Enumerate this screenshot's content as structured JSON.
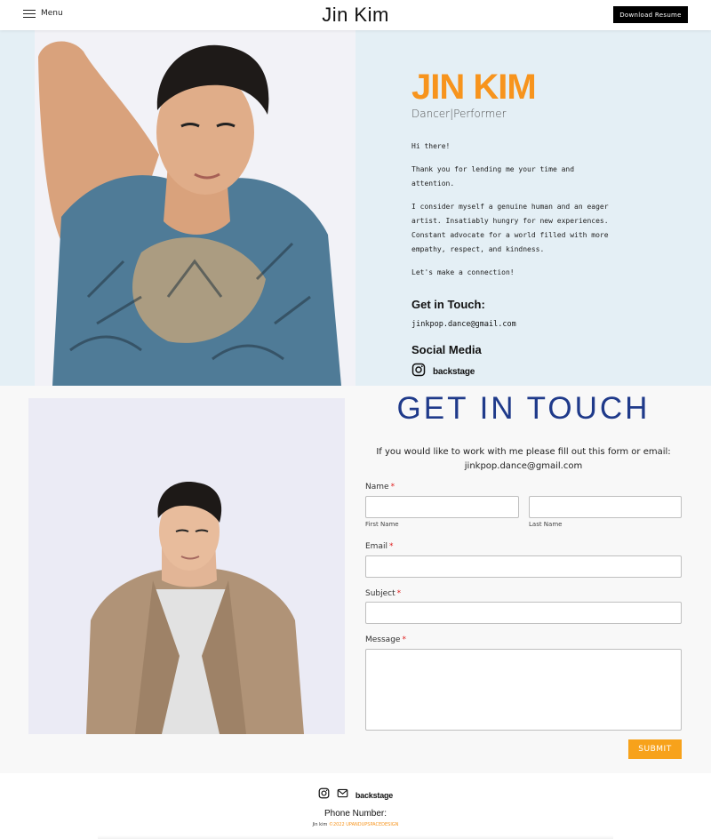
{
  "header": {
    "menu_label": "Menu",
    "site_title": "Jin Kim",
    "resume_button": "Download Resume"
  },
  "hero": {
    "name": "JIN KIM",
    "role": "Dancer|Performer",
    "greeting": "Hi there!",
    "thanks": "Thank you for lending me your time and attention.",
    "bio": "I consider myself a genuine human and an eager artist. Insatiably hungry for new experiences. Constant advocate for a world filled with more empathy, respect, and kindness.",
    "cta": "Let's make a connection!",
    "get_in_touch_heading": "Get in Touch:",
    "email": "jinkpop.dance@gmail.com",
    "social_heading": "Social Media",
    "social_links": [
      "instagram-icon",
      "backstage"
    ],
    "backstage_label": "backstage"
  },
  "contact": {
    "title": "GET IN TOUCH",
    "intro_line1": "If you would like to work with me please fill out this form or email:",
    "intro_line2": "jinkpop.dance@gmail.com",
    "fields": {
      "name_label": "Name",
      "first_name_sub": "First Name",
      "last_name_sub": "Last Name",
      "email_label": "Email",
      "subject_label": "Subject",
      "message_label": "Message",
      "required_mark": "*"
    },
    "submit_label": "SUBMIT"
  },
  "footer": {
    "icons": [
      "instagram-icon",
      "mail-icon"
    ],
    "backstage_label": "backstage",
    "phone_label": "Phone Number:",
    "copyright_name": "Jin kim",
    "copyright_credit": "©2022 UPANDUPSPACEDESIGN"
  },
  "colors": {
    "accent_orange": "#f7941d",
    "title_blue": "#1f3a8a",
    "hero_bg": "#e4eff5",
    "submit_bg": "#f7a21b"
  }
}
